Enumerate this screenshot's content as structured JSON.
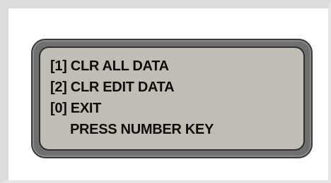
{
  "lcd": {
    "lines": [
      "[1] CLR ALL DATA",
      "[2] CLR EDIT DATA",
      "[0] EXIT",
      "PRESS NUMBER KEY"
    ]
  }
}
